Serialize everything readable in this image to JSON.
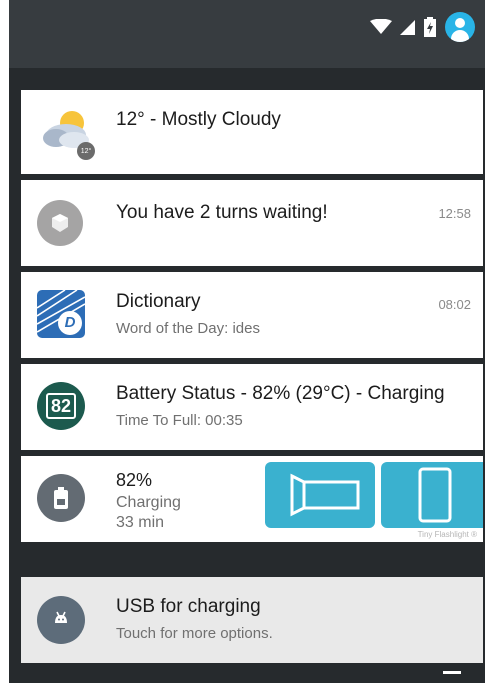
{
  "notifications": [
    {
      "id": "weather",
      "title": "12° -  Mostly Cloudy",
      "icon": "cloudy-weather-icon",
      "badge": "12°"
    },
    {
      "id": "game",
      "title": "You have 2 turns waiting!",
      "time": "12:58",
      "icon": "game-icon"
    },
    {
      "id": "dictionary",
      "title": "Dictionary",
      "subtitle": "Word of the Day: ides",
      "time": "08:02",
      "icon": "dictionary-icon",
      "icon_letter": "D"
    },
    {
      "id": "battery-status",
      "title": "Battery Status - 82% (29°C) - Charging",
      "subtitle": "Time To Full: 00:35",
      "icon": "battery-level-icon",
      "badge": "82"
    },
    {
      "id": "flashlight",
      "line1": "82%",
      "line2": "Charging",
      "line3": "33 min",
      "caption": "Tiny Flashlight ®",
      "icon": "battery-icon"
    },
    {
      "id": "usb",
      "title": "USB for charging",
      "subtitle": "Touch for more options.",
      "icon": "android-icon"
    }
  ],
  "status_bar": {
    "icons": [
      "wifi-icon",
      "signal-icon",
      "battery-icon",
      "account-icon"
    ]
  },
  "colors": {
    "accent": "#3ab1cf",
    "panel": "#262a2d",
    "status_bar": "#373c40",
    "battery_badge": "#1c5a4e",
    "avatar": "#29b4e7"
  }
}
